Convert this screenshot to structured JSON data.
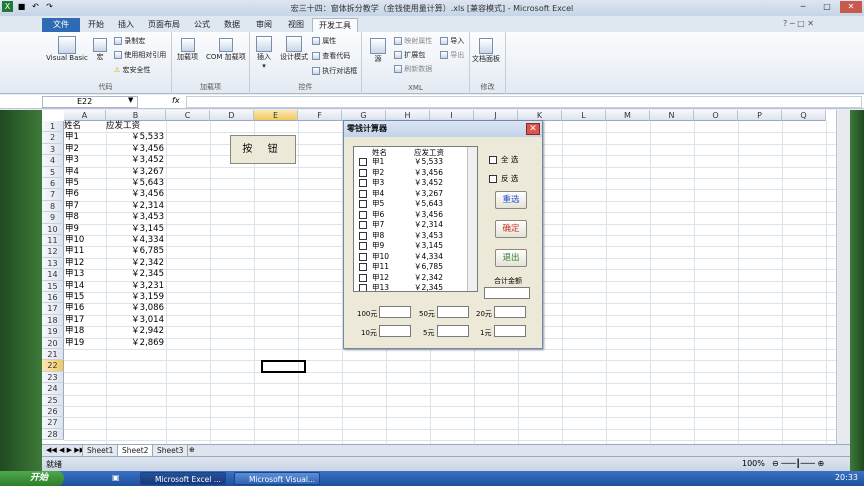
{
  "window": {
    "title": "宏三十四：窗体拆分教学（金钱使用量计算）.xls  [兼容模式] - Microsoft Excel"
  },
  "tabs": [
    "文件",
    "开始",
    "插入",
    "页面布局",
    "公式",
    "数据",
    "审阅",
    "视图",
    "开发工具"
  ],
  "active_tab": "开发工具",
  "ribbon": {
    "code": {
      "label": "代码",
      "vb": "Visual Basic",
      "macro": "宏",
      "record": "录制宏",
      "relative": "使用相对引用",
      "security": "宏安全性"
    },
    "addins": {
      "label": "加载项",
      "addin": "加载项",
      "com": "COM 加载项"
    },
    "controls": {
      "label": "控件",
      "insert": "插入",
      "design": "设计模式",
      "props": "属性",
      "viewcode": "查看代码",
      "rundlg": "执行对话框"
    },
    "xml": {
      "label": "XML",
      "source": "源",
      "mapprops": "映射属性",
      "expand": "扩展包",
      "refresh": "刷新数据",
      "import": "导入",
      "export": "导出"
    },
    "modify": {
      "label": "修改",
      "docpanel": "文档面板"
    }
  },
  "formula_bar": {
    "name_box": "E22",
    "fx": "fx"
  },
  "columns": [
    "A",
    "B",
    "C",
    "D",
    "E",
    "F",
    "G",
    "H",
    "I",
    "J",
    "K",
    "L",
    "M",
    "N",
    "O",
    "P",
    "Q"
  ],
  "rows": [
    "1",
    "2",
    "3",
    "4",
    "5",
    "6",
    "7",
    "8",
    "9",
    "10",
    "11",
    "12",
    "13",
    "14",
    "15",
    "16",
    "17",
    "18",
    "19",
    "20",
    "21",
    "22",
    "23",
    "24",
    "25",
    "26",
    "27",
    "28"
  ],
  "sheet": {
    "header": [
      "姓名",
      "应发工资"
    ],
    "data": [
      [
        "甲1",
        "￥5,533"
      ],
      [
        "甲2",
        "￥3,456"
      ],
      [
        "甲3",
        "￥3,452"
      ],
      [
        "甲4",
        "￥3,267"
      ],
      [
        "甲5",
        "￥5,643"
      ],
      [
        "甲6",
        "￥3,456"
      ],
      [
        "甲7",
        "￥2,314"
      ],
      [
        "甲8",
        "￥3,453"
      ],
      [
        "甲9",
        "￥3,145"
      ],
      [
        "甲10",
        "￥4,334"
      ],
      [
        "甲11",
        "￥6,785"
      ],
      [
        "甲12",
        "￥2,342"
      ],
      [
        "甲13",
        "￥2,345"
      ],
      [
        "甲14",
        "￥3,231"
      ],
      [
        "甲15",
        "￥3,159"
      ],
      [
        "甲16",
        "￥3,086"
      ],
      [
        "甲17",
        "￥3,014"
      ],
      [
        "甲18",
        "￥2,942"
      ],
      [
        "甲19",
        "￥2,869"
      ]
    ],
    "button_label": "按 钮"
  },
  "dialog": {
    "title": "零钱计算器",
    "list_headers": [
      "姓名",
      "应发工资"
    ],
    "list_rows": [
      [
        "甲1",
        "￥5,533"
      ],
      [
        "甲2",
        "￥3,456"
      ],
      [
        "甲3",
        "￥3,452"
      ],
      [
        "甲4",
        "￥3,267"
      ],
      [
        "甲5",
        "￥5,643"
      ],
      [
        "甲6",
        "￥3,456"
      ],
      [
        "甲7",
        "￥2,314"
      ],
      [
        "甲8",
        "￥3,453"
      ],
      [
        "甲9",
        "￥3,145"
      ],
      [
        "甲10",
        "￥4,334"
      ],
      [
        "甲11",
        "￥6,785"
      ],
      [
        "甲12",
        "￥2,342"
      ],
      [
        "甲13",
        "￥2,345"
      ]
    ],
    "select_all": "全 选",
    "invert": "反 选",
    "reselect": "重选",
    "confirm": "确定",
    "exit": "退出",
    "total_label": "合计金额",
    "denoms": [
      "100元",
      "50元",
      "20元",
      "10元",
      "5元",
      "1元"
    ]
  },
  "sheet_tabs": [
    "Sheet1",
    "Sheet2",
    "Sheet3"
  ],
  "active_sheet": "Sheet2",
  "status": {
    "ready": "就绪",
    "zoom": "100%"
  },
  "taskbar": {
    "start": "开始",
    "items": [
      "Microsoft Excel ...",
      "Microsoft Visual..."
    ],
    "clock": "20:33"
  }
}
